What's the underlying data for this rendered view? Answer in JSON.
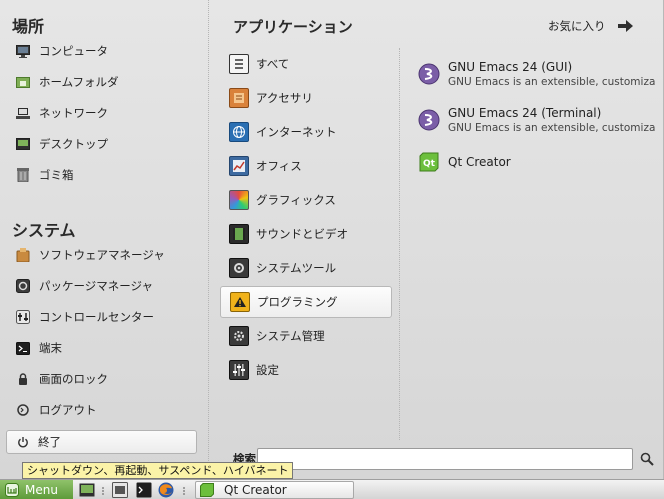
{
  "places": {
    "title": "場所",
    "items": [
      {
        "label": "コンピュータ",
        "icon": "computer-icon"
      },
      {
        "label": "ホームフォルダ",
        "icon": "home-folder-icon"
      },
      {
        "label": "ネットワーク",
        "icon": "network-icon"
      },
      {
        "label": "デスクトップ",
        "icon": "desktop-icon"
      },
      {
        "label": "ゴミ箱",
        "icon": "trash-icon"
      }
    ]
  },
  "system": {
    "title": "システム",
    "items": [
      {
        "label": "ソフトウェアマネージャ",
        "icon": "software-manager-icon"
      },
      {
        "label": "パッケージマネージャ",
        "icon": "package-manager-icon"
      },
      {
        "label": "コントロールセンター",
        "icon": "control-center-icon"
      },
      {
        "label": "端末",
        "icon": "terminal-icon"
      },
      {
        "label": "画面のロック",
        "icon": "lock-icon"
      },
      {
        "label": "ログアウト",
        "icon": "logout-icon"
      }
    ],
    "quit_label": "終了",
    "quit_tooltip": "シャットダウン、再起動、サスペンド、ハイバネート"
  },
  "applications": {
    "title": "アプリケーション",
    "favorites_label": "お気に入り",
    "categories": [
      {
        "label": "すべて",
        "icon": "all-apps-icon"
      },
      {
        "label": "アクセサリ",
        "icon": "accessories-icon"
      },
      {
        "label": "インターネット",
        "icon": "internet-icon"
      },
      {
        "label": "オフィス",
        "icon": "office-icon"
      },
      {
        "label": "グラフィックス",
        "icon": "graphics-icon"
      },
      {
        "label": "サウンドとビデオ",
        "icon": "sound-video-icon"
      },
      {
        "label": "システムツール",
        "icon": "system-tools-icon"
      },
      {
        "label": "プログラミング",
        "icon": "programming-icon",
        "selected": true
      },
      {
        "label": "システム管理",
        "icon": "administration-icon"
      },
      {
        "label": "設定",
        "icon": "preferences-icon"
      }
    ],
    "apps": [
      {
        "name": "GNU Emacs 24 (GUI)",
        "description": "GNU Emacs is an extensible, customiza",
        "icon": "emacs-icon"
      },
      {
        "name": "GNU Emacs 24 (Terminal)",
        "description": "GNU Emacs is an extensible, customiza",
        "icon": "emacs-icon"
      },
      {
        "name": "Qt Creator",
        "description": "",
        "icon": "qt-creator-icon"
      }
    ]
  },
  "search": {
    "label": "検索:",
    "value": ""
  },
  "taskbar": {
    "menu_label": "Menu",
    "task_label": "Qt Creator"
  },
  "colors": {
    "mint_green": "#6aa84f",
    "tooltip_bg": "#fbf3a8",
    "emacs_purple": "#7b5ea7",
    "qt_green": "#6cbf3c"
  }
}
